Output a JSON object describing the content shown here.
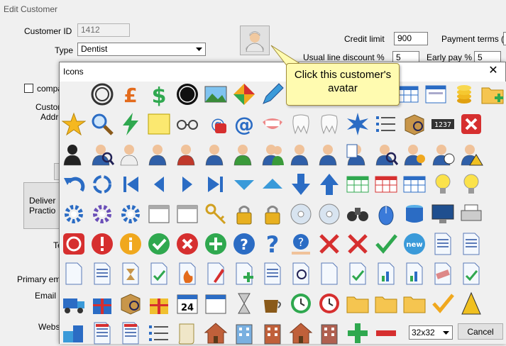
{
  "window": {
    "title": "Edit Customer"
  },
  "form": {
    "customer_id_label": "Customer ID",
    "customer_id_value": "1412",
    "type_label": "Type",
    "type_value": "Dentist",
    "credit_limit_label": "Credit limit",
    "credit_limit_value": "900",
    "payment_terms_label": "Payment terms (d",
    "usual_discount_label": "Usual line discount %",
    "usual_discount_value": "5",
    "early_pay_label": "Early pay %",
    "early_pay_value": "5",
    "company_label": "compa",
    "customer_label": "Custor",
    "address_label": "Addre",
    "deliver_button": "Deliver\nPractio",
    "te_label": "Te",
    "primary_email_label": "Primary em",
    "email_label": "Email",
    "website_label": "Websi"
  },
  "callout": {
    "text": "Click this customer's avatar"
  },
  "dialog": {
    "title": "Icons",
    "size_value": "32x32",
    "cancel_label": "Cancel"
  },
  "icons": [
    [
      "target-icon",
      "pound-sign-icon",
      "dollar-sign-icon",
      "black-circle-icon",
      "picture-icon",
      "color-wheel-icon",
      "pencil-icon",
      "document-icon",
      "hidden",
      "hidden",
      "hidden",
      "hidden",
      "hidden",
      "table-icon",
      "form-icon",
      "coins-icon",
      "folder-add-icon"
    ],
    [
      "star-icon",
      "magnifier-icon",
      "lightning-icon",
      "sticky-note-icon",
      "glasses-icon",
      "phone-at-icon",
      "at-sign-icon",
      "dentures-icon",
      "teeth-icon",
      "tooth-icon",
      "burst-icon",
      "list-icon",
      "box-search-icon",
      "counter-icon",
      "close-red-icon",
      "paperclip-icon"
    ],
    [
      "user-silhouette-icon",
      "user-search-icon",
      "dentist-icon",
      "user-man-icon",
      "user-woman-icon",
      "user-bald-icon",
      "user-green-icon",
      "users-group-icon",
      "user-business-icon",
      "user-blue-icon",
      "user-card-icon",
      "user-magnify-icon",
      "user-at-icon",
      "user-clock-icon",
      "user-warning-icon",
      "exit-icon",
      "half-circle-icon"
    ],
    [
      "undo-icon",
      "refresh-icon",
      "first-icon",
      "prev-icon",
      "next-icon",
      "last-icon",
      "triangle-down-icon",
      "triangle-up-icon",
      "arrow-down-icon",
      "arrow-up-icon",
      "table-green-icon",
      "table-red-icon",
      "table-blue-icon",
      "bulb-off-icon",
      "bulb-on-icon"
    ],
    [
      "gears-blue-icon",
      "gears-purple-icon",
      "gear-blue-icon",
      "window-corner-icon",
      "window-edit-icon",
      "keys-icon",
      "padlock-key-icon",
      "padlock-icon",
      "document-cd-icon",
      "cd-icon",
      "binoculars-icon",
      "mouse-icon",
      "database-icon",
      "monitor-icon",
      "printer-icon"
    ],
    [
      "power-icon",
      "alert-icon",
      "info-icon",
      "check-circle-icon",
      "cross-circle-icon",
      "plus-circle-icon",
      "help-circle-icon",
      "question-icon",
      "help-hand-icon",
      "cross-red-icon",
      "cross-redx-icon",
      "checkmark-icon",
      "new-badge-icon",
      "doc-list-icon",
      "doc-checklist-icon"
    ],
    [
      "documents-icon",
      "document-text-icon",
      "hourglass-doc-icon",
      "doc-check-icon",
      "doc-fire-icon",
      "doc-edit-icon",
      "doc-add-icon",
      "doc-lines-icon",
      "doc-search-icon",
      "doc-blank-icon",
      "doc-tick-icon",
      "doc-chart-icon",
      "docs-chart-icon",
      "doc-eraser-icon",
      "doc-ok-icon"
    ],
    [
      "truck-icon",
      "gift-blue-icon",
      "boxes-icon",
      "gift-yellow-icon",
      "calendar-day-icon",
      "calendar-icon",
      "hourglass-icon",
      "coffee-icon",
      "clock-green-icon",
      "alarm-clock-icon",
      "folder-icon",
      "folder-open-icon",
      "folder-flat-icon",
      "checkmark-yellow-icon",
      "wet-floor-icon"
    ],
    [
      "blocks-icon",
      "invoice-icon",
      "invoice-at-icon",
      "list-box-icon",
      "scroll-icon",
      "house-icon",
      "building-blue-icon",
      "building-red-icon",
      "warehouse-icon",
      "building-small-icon",
      "plus-green-icon",
      "minus-red-icon"
    ]
  ],
  "colors": {
    "accent": "#0078d7",
    "callout_bg": "#fffbb0",
    "dialog_bg": "#f0f0f0"
  }
}
